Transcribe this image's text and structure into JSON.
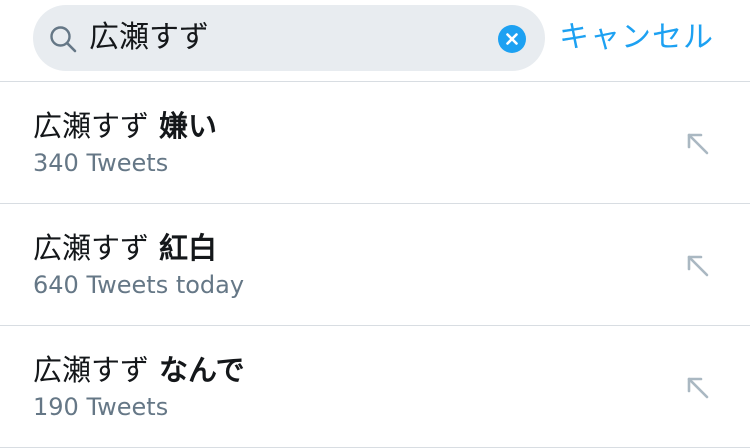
{
  "search": {
    "query": "広瀬すず",
    "cancel_label": "キャンセル"
  },
  "suggestions": [
    {
      "query": "広瀬すず",
      "completion": "嫌い",
      "count": "340 Tweets"
    },
    {
      "query": "広瀬すず",
      "completion": "紅白",
      "count": "640 Tweets today"
    },
    {
      "query": "広瀬すず",
      "completion": "なんで",
      "count": "190 Tweets"
    }
  ],
  "colors": {
    "accent": "#1da1f2",
    "field_background": "#e8ecf0",
    "secondary_text": "#657786",
    "divider": "#d8dde2",
    "icon_gray": "#aab8c2"
  },
  "icons": {
    "search": "magnifier-icon",
    "clear": "clear-x-icon",
    "fill_query": "arrow-up-left-icon"
  }
}
